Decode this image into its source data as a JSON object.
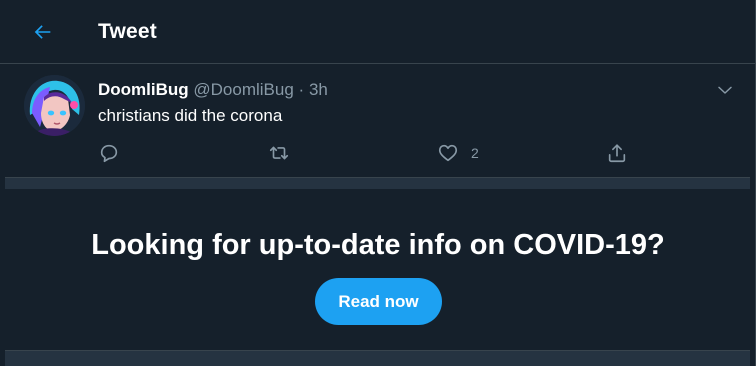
{
  "header": {
    "title": "Tweet",
    "back_icon": "arrow-left-icon"
  },
  "tweet": {
    "name": "DoomliBug",
    "handle": "@DoomliBug",
    "separator": "·",
    "time": "3h",
    "text": "christians did the corona",
    "more_icon": "chevron-down-icon",
    "actions": {
      "reply_icon": "reply-icon",
      "retweet_icon": "retweet-icon",
      "like_icon": "heart-icon",
      "like_count": "2",
      "share_icon": "share-icon"
    }
  },
  "covid_prompt": {
    "title": "Looking for up-to-date info on COVID-19?",
    "button_label": "Read now"
  },
  "colors": {
    "background": "#15202b",
    "border": "#38444d",
    "accent": "#1da1f2",
    "muted_text": "#8899a6"
  }
}
